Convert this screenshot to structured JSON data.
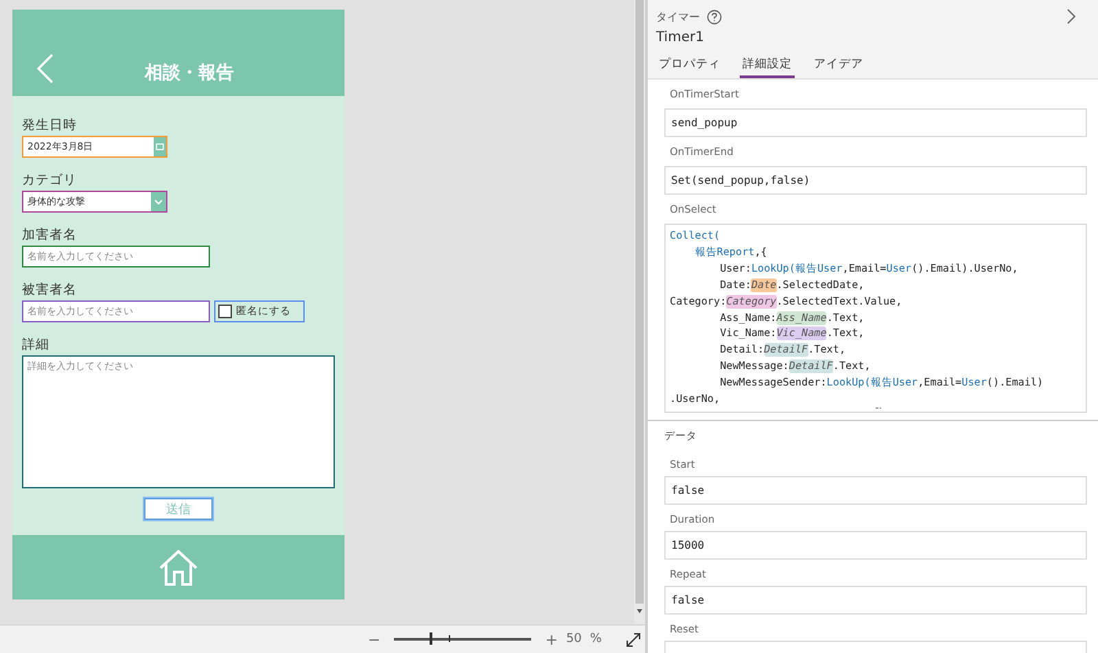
{
  "app_preview": {
    "header": {
      "title": "相談・報告"
    },
    "fields": [
      {
        "kind": "date",
        "label": "発生日時",
        "value": "2022年3月8日",
        "color": "#f59a32"
      },
      {
        "kind": "dropdown",
        "label": "カテゴリ",
        "value": "身体的な攻撃",
        "color": "#b0479c"
      },
      {
        "kind": "text",
        "label": "加害者名",
        "placeholder": "名前を入力してください",
        "color": "#2b8a3e"
      },
      {
        "kind": "text",
        "label": "被害者名",
        "placeholder": "名前を入力してください",
        "color": "#8b5cc8",
        "checkbox": {
          "label": "匿名にする",
          "checked": false,
          "color": "#5b8def"
        }
      },
      {
        "kind": "textarea",
        "label": "詳細",
        "placeholder": "詳細を入力してください",
        "color": "#1f6e73"
      }
    ],
    "submit_button": {
      "label": "送信",
      "selected": true
    }
  },
  "zoom_bar": {
    "zoom_out": "−",
    "zoom_in": "+",
    "level": 0.26,
    "value": "50",
    "unit": "%"
  },
  "properties_panel": {
    "control_type": "タイマー",
    "control_name": "Timer1",
    "tabs": [
      {
        "label": "プロパティ",
        "selected": false
      },
      {
        "label": "詳細設定",
        "selected": true
      },
      {
        "label": "アイデア",
        "selected": false
      }
    ],
    "action_properties": [
      {
        "name": "OnTimerStart",
        "value": "send_popup"
      },
      {
        "name": "OnTimerEnd",
        "value": "Set(send_popup,false)"
      }
    ],
    "onselect": {
      "name": "OnSelect",
      "lines": [
        [
          {
            "kind": "function",
            "text": "Collect("
          }
        ],
        [
          {
            "kind": "function",
            "text": "    報告Report"
          },
          {
            "kind": "plain",
            "text": ",{"
          }
        ],
        [
          {
            "kind": "plain",
            "text": "        User:"
          },
          {
            "kind": "function",
            "text": "LookUp("
          },
          {
            "kind": "function",
            "text": "報告User"
          },
          {
            "kind": "plain",
            "text": ",Email="
          },
          {
            "kind": "function",
            "text": "User"
          },
          {
            "kind": "plain",
            "text": "().Email).UserNo,"
          }
        ],
        [
          {
            "kind": "plain",
            "text": "        Date:"
          },
          {
            "kind": "control",
            "text": "Date",
            "color": "#f8c79a"
          },
          {
            "kind": "plain",
            "text": ".SelectedDate,"
          }
        ],
        [
          {
            "kind": "plain",
            "text": "Category:"
          },
          {
            "kind": "control",
            "text": "Category",
            "color": "#efc6e4"
          },
          {
            "kind": "plain",
            "text": ".SelectedText.Value,"
          }
        ],
        [
          {
            "kind": "plain",
            "text": "        Ass_Name:"
          },
          {
            "kind": "control",
            "text": "Ass_Name",
            "color": "#cfe6d3"
          },
          {
            "kind": "plain",
            "text": ".Text,"
          }
        ],
        [
          {
            "kind": "plain",
            "text": "        Vic_Name:"
          },
          {
            "kind": "control",
            "text": "Vic_Name",
            "color": "#dccdf0"
          },
          {
            "kind": "plain",
            "text": ".Text,"
          }
        ],
        [
          {
            "kind": "plain",
            "text": "        Detail:"
          },
          {
            "kind": "control",
            "text": "DetailF",
            "color": "#cfe3e3"
          },
          {
            "kind": "plain",
            "text": ".Text,"
          }
        ],
        [
          {
            "kind": "plain",
            "text": "        NewMessage:"
          },
          {
            "kind": "control",
            "text": "DetailF",
            "color": "#cfe3e3"
          },
          {
            "kind": "plain",
            "text": ".Text,"
          }
        ],
        [
          {
            "kind": "plain",
            "text": "        NewMessageSender:"
          },
          {
            "kind": "function",
            "text": "LookUp("
          },
          {
            "kind": "function",
            "text": "報告User"
          },
          {
            "kind": "plain",
            "text": ",Email="
          },
          {
            "kind": "function",
            "text": "User"
          },
          {
            "kind": "plain",
            "text": "().Email)"
          }
        ],
        [
          {
            "kind": "plain",
            "text": ".UserNo,"
          }
        ]
      ]
    },
    "data_section": {
      "title": "データ",
      "properties": [
        {
          "name": "Start",
          "value": "false"
        },
        {
          "name": "Duration",
          "value": "15000"
        },
        {
          "name": "Repeat",
          "value": "false"
        },
        {
          "name": "Reset"
        }
      ]
    }
  }
}
